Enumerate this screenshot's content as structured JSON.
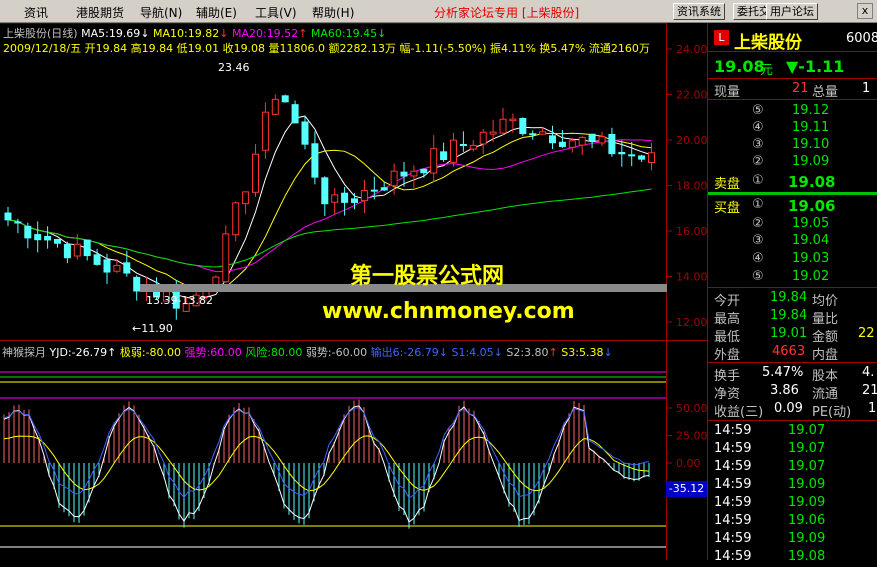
{
  "menu": {
    "items": [
      "资讯",
      "港股期货",
      "导航(N)",
      "辅助(E)",
      "工具(V)",
      "帮助(H)"
    ],
    "app_title": "分析家论坛专用 [上柴股份]",
    "buttons": [
      "资讯系统",
      "委托交易",
      "用户论坛"
    ],
    "close_label": "x"
  },
  "price_chart": {
    "stock_title": "上柴股份(日线)",
    "ma5": "MA5:19.69",
    "ma10": "MA10:19.82",
    "ma20": "MA20:19.52",
    "ma60": "MA60:19.45",
    "info_line": "2009/12/18/五 开19.84 高19.84 低19.01 收19.08 量11806.0 额2282.13万 幅-1.11(-5.50%) 振4.11% 换5.47% 流通2160万",
    "y_ticks": [
      "24.00",
      "22.00",
      "20.00",
      "18.00",
      "16.00",
      "14.00",
      "12.00"
    ],
    "high_label": "23.46",
    "low_label": "←11.90",
    "range_label": "13.39-13.82",
    "watermark_title": "第一股票公式网",
    "watermark_url": "www.chnmoney.com"
  },
  "indicator": {
    "name": "神猴探月",
    "yjd": "YJD:-26.79",
    "jiruo": "极弱:-80.00",
    "qiangshi": "强势:60.00",
    "fengxian": "风险:80.00",
    "ruoshi": "弱势:-60.00",
    "shuchu6": "输出6:-26.79",
    "s1": "S1:4.05",
    "s2": "S2:3.80",
    "s3": "S3:5.38",
    "y_ticks": [
      "50.00",
      "25.00",
      "0.00"
    ],
    "current_value": "-35.12"
  },
  "quote": {
    "name": "上柴股份",
    "code": "6008",
    "logo": "L",
    "price": "19.08",
    "unit": "元",
    "change": "▼-1.11",
    "xianliang_label": "现量",
    "xianliang": "21",
    "zongliang_label": "总量",
    "zongliang": "1",
    "sell": [
      {
        "label": "⑤",
        "price": "19.12"
      },
      {
        "label": "④",
        "price": "19.11"
      },
      {
        "label": "③",
        "price": "19.10"
      },
      {
        "label": "②",
        "price": "19.09"
      },
      {
        "label": "①",
        "price": "19.08"
      }
    ],
    "sell_title": "卖盘",
    "buy_title": "买盘",
    "buy": [
      {
        "label": "①",
        "price": "19.06"
      },
      {
        "label": "②",
        "price": "19.05"
      },
      {
        "label": "③",
        "price": "19.04"
      },
      {
        "label": "④",
        "price": "19.03"
      },
      {
        "label": "⑤",
        "price": "19.02"
      }
    ],
    "stats": [
      {
        "l1": "今开",
        "v1": "19.84",
        "l2": "均价",
        "v2": ""
      },
      {
        "l1": "最高",
        "v1": "19.84",
        "l2": "量比",
        "v2": ""
      },
      {
        "l1": "最低",
        "v1": "19.01",
        "l2": "金额",
        "v2": "22"
      },
      {
        "l1": "外盘",
        "v1": "4663",
        "l2": "内盘",
        "v2": ""
      },
      {
        "l1": "换手",
        "v1": "5.47%",
        "l2": "股本",
        "v2": "4."
      },
      {
        "l1": "净资",
        "v1": "3.86",
        "l2": "流通",
        "v2": "21"
      },
      {
        "l1": "收益(三)",
        "v1": "0.09",
        "l2": "PE(动)",
        "v2": "1"
      }
    ],
    "ticks": [
      {
        "time": "14:59",
        "price": "19.07"
      },
      {
        "time": "14:59",
        "price": "19.07"
      },
      {
        "time": "14:59",
        "price": "19.07"
      },
      {
        "time": "14:59",
        "price": "19.09"
      },
      {
        "time": "14:59",
        "price": "19.09"
      },
      {
        "time": "14:59",
        "price": "19.06"
      },
      {
        "time": "14:59",
        "price": "19.09"
      },
      {
        "time": "14:59",
        "price": "19.08"
      }
    ]
  }
}
